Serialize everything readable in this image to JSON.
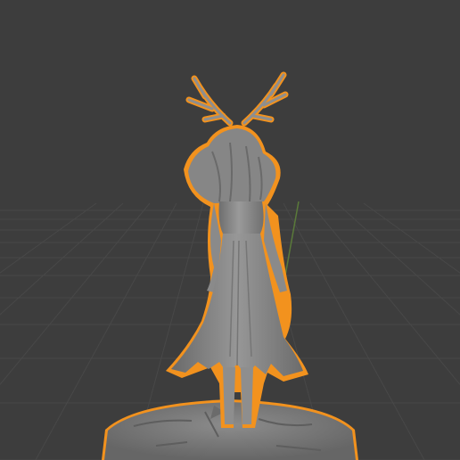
{
  "viewport": {
    "background": "#3d3d3d",
    "grid_color": "#4a4a4a",
    "axis_y_color": "#5a7a3a",
    "selection_outline_color": "#f2921e",
    "mesh_color": "#8a8a8a",
    "base_color": "#7c7c7c",
    "selected_object": "deer-antlered-woman-figurine"
  }
}
